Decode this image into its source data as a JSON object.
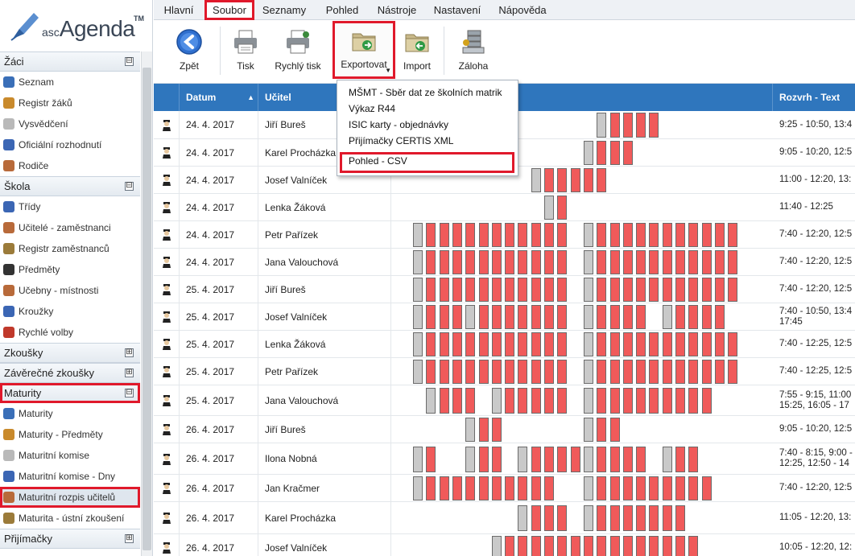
{
  "app": {
    "logo_prefix": "asc",
    "logo_name": "Agenda",
    "logo_tm": "TM"
  },
  "sidebar": {
    "sections": [
      {
        "label": "Žáci",
        "state": "⊟",
        "items": [
          "Seznam",
          "Registr žáků",
          "Vysvědčení",
          "Oficiální rozhodnutí",
          "Rodiče"
        ]
      },
      {
        "label": "Škola",
        "state": "⊟",
        "items": [
          "Třídy",
          "Učitelé - zaměstnanci",
          "Registr zaměstnanců",
          "Předměty",
          "Učebny - místnosti",
          "Kroužky",
          "Rychlé volby"
        ]
      },
      {
        "label": "Zkoušky",
        "state": "⊞",
        "items": []
      },
      {
        "label": "Závěrečné zkoušky",
        "state": "⊞",
        "items": []
      },
      {
        "label": "Maturity",
        "state": "⊟",
        "items": [
          "Maturity",
          "Maturity - Předměty",
          "Maturitní komise",
          "Maturitní komise - Dny",
          "Maturitní rozpis učitelů",
          "Maturita - ústní zkoušení"
        ]
      },
      {
        "label": "Přijímačky",
        "state": "⊞",
        "items": []
      }
    ],
    "highlighted_section": "Maturity",
    "selected_item": "Maturitní rozpis učitelů"
  },
  "menu": {
    "tabs": [
      "Hlavní",
      "Soubor",
      "Seznamy",
      "Pohled",
      "Nástroje",
      "Nastavení",
      "Nápověda"
    ],
    "active": "Soubor"
  },
  "toolbar": {
    "back": "Zpět",
    "print": "Tisk",
    "quick_print": "Rychlý tisk",
    "export": "Exportovat",
    "import": "Import",
    "backup": "Záloha"
  },
  "export_menu": {
    "items": [
      "MŠMT - Sběr dat ze školních matrik",
      "Výkaz R44",
      "ISIC karty - objednávky",
      "Přijímačky CERTIS XML",
      "Pohled - CSV"
    ],
    "highlighted": "Pohled - CSV"
  },
  "grid": {
    "columns": {
      "date": "Datum",
      "teacher": "Učitel",
      "schedule": "Rozvrh - Text"
    },
    "sort_indicator": "▲",
    "rows": [
      {
        "date": "24. 4. 2017",
        "teacher": "Jiří Bureš",
        "schedule": "9:25 - 10:50, 13:4"
      },
      {
        "date": "24. 4. 2017",
        "teacher": "Karel Procházka",
        "schedule": "9:05 - 10:20, 12:5"
      },
      {
        "date": "24. 4. 2017",
        "teacher": "Josef Valníček",
        "schedule": "11:00 - 12:20, 13:"
      },
      {
        "date": "24. 4. 2017",
        "teacher": "Lenka Žáková",
        "schedule": "11:40 - 12:25"
      },
      {
        "date": "24. 4. 2017",
        "teacher": "Petr Pařízek",
        "schedule": "7:40 - 12:20, 12:5"
      },
      {
        "date": "24. 4. 2017",
        "teacher": "Jana Valouchová",
        "schedule": "7:40 - 12:20, 12:5"
      },
      {
        "date": "25. 4. 2017",
        "teacher": "Jiří Bureš",
        "schedule": "7:40 - 12:20, 12:5"
      },
      {
        "date": "25. 4. 2017",
        "teacher": "Josef Valníček",
        "schedule": "7:40 - 10:50, 13:4\n17:45"
      },
      {
        "date": "25. 4. 2017",
        "teacher": "Lenka Žáková",
        "schedule": "7:40 - 12:25, 12:5"
      },
      {
        "date": "25. 4. 2017",
        "teacher": "Petr Pařízek",
        "schedule": "7:40 - 12:25, 12:5"
      },
      {
        "date": "25. 4. 2017",
        "teacher": "Jana Valouchová",
        "schedule": "7:55 - 9:15, 11:00\n15:25, 16:05 - 17"
      },
      {
        "date": "26. 4. 2017",
        "teacher": "Jiří Bureš",
        "schedule": "9:05 - 10:20, 12:5"
      },
      {
        "date": "26. 4. 2017",
        "teacher": "Ilona Nobná",
        "schedule": "7:40 - 8:15, 9:00 -\n12:25, 12:50 - 14"
      },
      {
        "date": "26. 4. 2017",
        "teacher": "Jan Kračmer",
        "schedule": "7:40 - 12:20, 12:5"
      },
      {
        "date": "26. 4. 2017",
        "teacher": "Karel Procházka",
        "schedule": "11:05 - 12:20, 13:"
      },
      {
        "date": "26. 4. 2017",
        "teacher": "Josef Valníček",
        "schedule": "10:05 - 12:20, 12:"
      }
    ]
  },
  "colors": {
    "header": "#2f76bd",
    "slot_red": "#f05a5a",
    "slot_gray": "#c9c9c9",
    "highlight": "#e0192b"
  }
}
